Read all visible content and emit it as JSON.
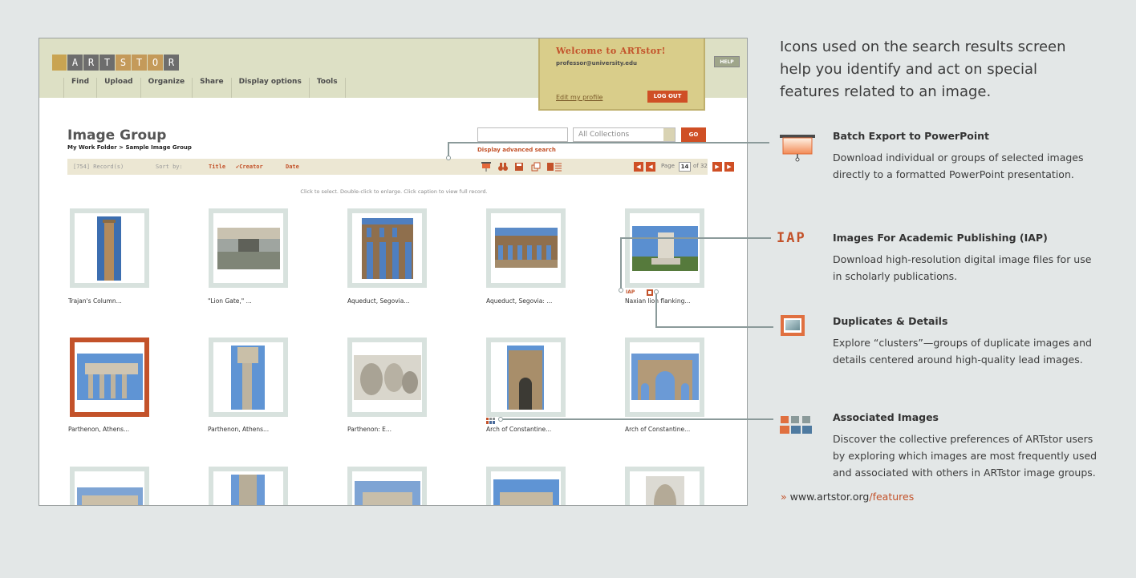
{
  "app": {
    "logo_letters": [
      "A",
      "R",
      "T",
      "S",
      "T",
      "O",
      "R"
    ],
    "nav": [
      "Find",
      "Upload",
      "Organize",
      "Share",
      "Display options",
      "Tools"
    ],
    "welcome": {
      "title": "Welcome to ARTstor!",
      "email": "professor@university.edu",
      "edit_profile": "Edit my profile",
      "logout": "LOG OUT"
    },
    "help": "HELP",
    "page_title": "Image Group",
    "breadcrumb": "My Work Folder > Sample Image Group",
    "search": {
      "value": "",
      "collection": "All Collections",
      "go": "GO",
      "advanced": "Display advanced search"
    },
    "toolbar": {
      "records": "[754] Record(s)",
      "sort_by": "Sort by:",
      "sort_title": "Title",
      "sort_creator": "✔Creator",
      "sort_date": "Date",
      "page_label": "Page",
      "page_current": "14",
      "page_total": "of 32"
    },
    "instructions": "Click to select. Double-click to enlarge. Click caption to view full record.",
    "thumbnails": [
      {
        "caption": "Trajan's Column..."
      },
      {
        "caption": "\"Lion Gate,\" ..."
      },
      {
        "caption": "Aqueduct, Segovia..."
      },
      {
        "caption": "Aqueduct, Segovia: ..."
      },
      {
        "caption": "Naxian lion flanking..."
      },
      {
        "caption": "Parthenon, Athens..."
      },
      {
        "caption": "Parthenon, Athens..."
      },
      {
        "caption": "Parthenon: E..."
      },
      {
        "caption": "Arch of Constantine..."
      },
      {
        "caption": "Arch of Constantine..."
      }
    ],
    "iap_mini": "IAP"
  },
  "panel": {
    "intro": "Icons used on the search results screen help you identify and act on special features related to an image.",
    "features": [
      {
        "icon": "powerpoint-export-icon",
        "title": "Batch Export to PowerPoint",
        "desc": "Download individual or groups of selected images directly to a formatted PowerPoint presentation."
      },
      {
        "icon": "iap-icon",
        "icon_text": "IAP",
        "title": "Images For Academic Publishing (IAP)",
        "desc": "Download high-resolution digital image files for use in scholarly publications."
      },
      {
        "icon": "duplicates-icon",
        "title": "Duplicates & Details",
        "desc": "Explore “clusters”—groups of duplicate images and details centered around high-quality lead images."
      },
      {
        "icon": "associated-images-icon",
        "title": "Associated Images",
        "desc": "Discover the collective preferences of ARTstor users by exploring which images are most frequently used and associated with others in ARTstor image groups."
      }
    ],
    "link_prefix": "»",
    "link_base": "www.artstor.org",
    "link_path": "/features"
  },
  "colors": {
    "accent": "#c3522a",
    "background": "#e3e7e7",
    "topbar": "#dde0c5"
  }
}
